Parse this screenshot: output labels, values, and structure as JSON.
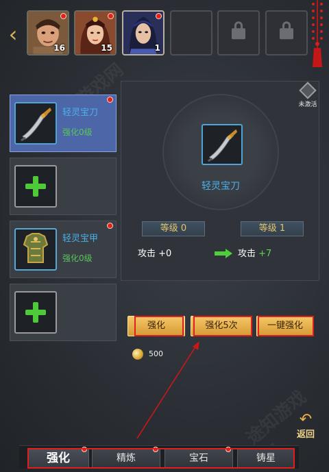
{
  "hero_bar": {
    "heroes": [
      {
        "level": "16",
        "has_badge": true
      },
      {
        "level": "15",
        "has_badge": true
      },
      {
        "level": "1",
        "has_badge": true
      }
    ],
    "locked_slots": 3
  },
  "equipment_list": [
    {
      "name": "轻灵宝刀",
      "status": "强化0级",
      "selected": true,
      "has_badge": true
    },
    {
      "empty": true
    },
    {
      "name": "轻灵宝甲",
      "status": "强化0级",
      "selected": false,
      "has_badge": true
    },
    {
      "empty": true
    }
  ],
  "detail": {
    "item_name": "轻灵宝刀",
    "activation_status": "未激活",
    "current_level_label": "等级 0",
    "next_level_label": "等级 1",
    "current_stat_label": "攻击",
    "current_stat_value": "+0",
    "next_stat_label": "攻击",
    "next_stat_value": "+7"
  },
  "actions": {
    "enhance": "强化",
    "enhance_5x": "强化5次",
    "enhance_all": "一键强化"
  },
  "cost": {
    "amount": "500"
  },
  "return_button": {
    "label": "返回"
  },
  "tabs": [
    {
      "label": "强化",
      "active": true,
      "has_badge": true
    },
    {
      "label": "精炼",
      "active": false,
      "has_badge": true
    },
    {
      "label": "宝石",
      "active": false,
      "has_badge": true
    },
    {
      "label": "铸星",
      "active": false,
      "has_badge": false
    }
  ],
  "colors": {
    "item_name_blue": "#4ab0ea",
    "status_green": "#58c65c",
    "level_gold": "#e2c56c",
    "button_gold": "#f6c768",
    "badge_red": "#e0231f",
    "annotation_red": "#e02020"
  }
}
